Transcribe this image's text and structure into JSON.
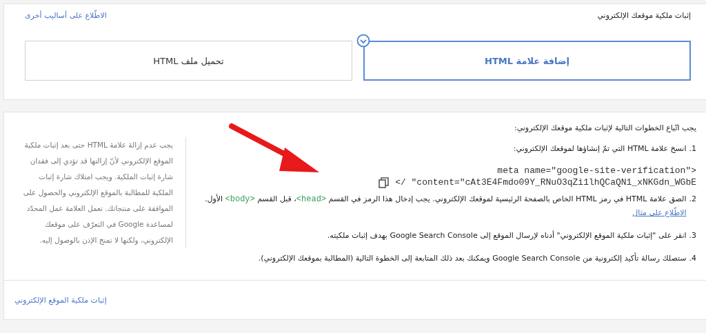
{
  "header": {
    "title": "إثبات ملكية موقعك الإلكتروني",
    "link": "الاطّلاع على أساليب أخرى"
  },
  "methods": [
    {
      "label": "إضافة علامة HTML",
      "selected": true
    },
    {
      "label": "تحميل ملف HTML",
      "selected": false
    }
  ],
  "instructions": {
    "intro": "يجب اتّباع الخطوات التالية لإثبات ملكية موقعك الإلكتروني:",
    "steps": [
      {
        "number": "1.",
        "parts": [
          {
            "kind": "text",
            "text": "انسخ علامة HTML التي تمّ إنشاؤها لموقعك الإلكتروني:"
          }
        ],
        "code_lines": [
          "meta name=\"google-site-verification\">",
          "</  \"content=\"cAt3E4Fmdo09Y_RNuO3qZi1lhQCaQN1_xNKGdn_WGbE"
        ]
      },
      {
        "number": "2.",
        "parts": [
          {
            "kind": "text",
            "text": "الصق علامة HTML في رمز HTML الخاص بالصفحة الرئيسية لموقعك الإلكتروني. يجب إدخال هذا الرمز في القسم "
          },
          {
            "kind": "code",
            "text": "<head>"
          },
          {
            "kind": "text",
            "text": "، قبل القسم "
          },
          {
            "kind": "code",
            "text": "<body>"
          },
          {
            "kind": "text",
            "text": " الأول. "
          },
          {
            "kind": "link",
            "text": "الاطّلاع على مثال"
          }
        ]
      },
      {
        "number": "3.",
        "parts": [
          {
            "kind": "text",
            "text": "انقر على \"إثبات ملكية الموقع الإلكتروني\" أدناه لإرسال الموقع إلى Google Search Console بهدف إثبات ملكيته."
          }
        ]
      },
      {
        "number": "4.",
        "parts": [
          {
            "kind": "text",
            "text": "ستصلك رسالة تأكيد إلكترونية من Google Search Console ويمكنك بعد ذلك المتابعة إلى الخطوة التالية (المطالبة بموقعك الإلكتروني)."
          }
        ]
      }
    ],
    "note": "يجب عدم إزالة علامة HTML حتى بعد إثبات ملكية الموقع الإلكتروني لأنّ إزالتها قد تؤدي إلى فقدان شارة إثبات الملكية. ويجب امتلاك شارة إثبات الملكية للمطالبة بالموقع الإلكتروني والحصول على الموافقة على منتجاتك. تعمل العلامة عمل المحدّد لمساعدة Google في التعرّف على موقعك الإلكتروني، ولكنها لا تمنح الإذن بالوصول إليه.",
    "verify_link": "إثبات ملكية الموقع الإلكتروني"
  }
}
